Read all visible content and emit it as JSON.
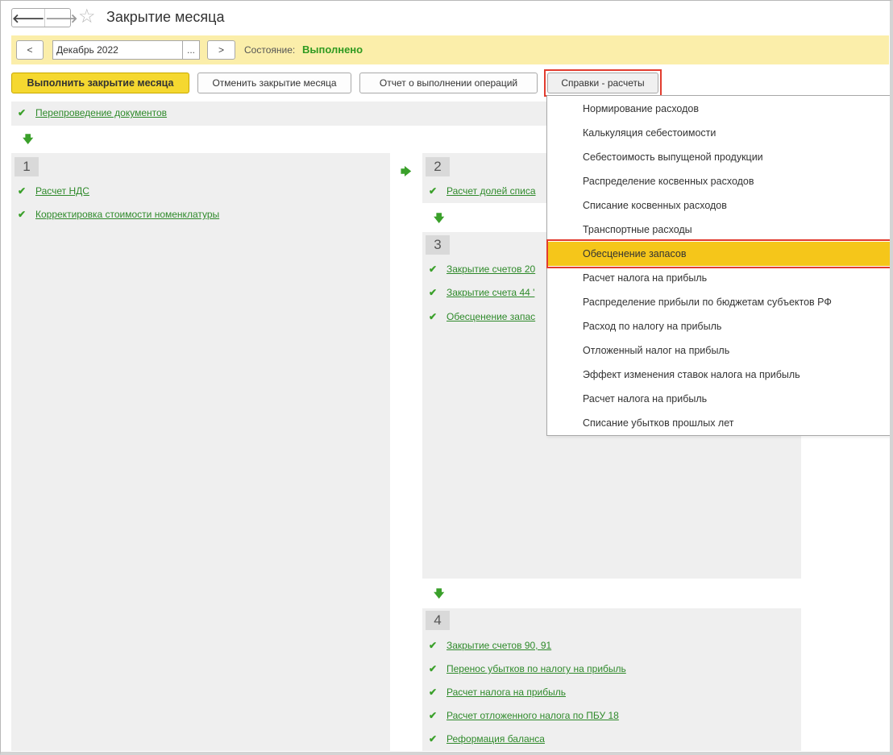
{
  "window": {
    "title": "Закрытие месяца",
    "back_glyph": "🡐",
    "forward_glyph": "🡒",
    "star_glyph": "☆"
  },
  "period_bar": {
    "prev_label": "<",
    "next_label": ">",
    "period_value": "Декабрь 2022",
    "select_label": "...",
    "state_label": "Состояние:",
    "state_value": "Выполнено"
  },
  "toolbar": {
    "run_label": "Выполнить закрытие месяца",
    "cancel_label": "Отменить закрытие месяца",
    "report_label": "Отчет о выполнении операций",
    "reports_menu_label": "Справки - расчеты"
  },
  "operations": {
    "reposting": "Перепроведение документов",
    "step1": {
      "number": "1",
      "items": [
        "Расчет НДС",
        "Корректировка стоимости номенклатуры"
      ]
    },
    "step2": {
      "number": "2",
      "items": [
        "Расчет долей списа"
      ]
    },
    "step3": {
      "number": "3",
      "items": [
        "Закрытие счетов 20",
        "Закрытие счета 44 '",
        "Обесценение запас"
      ]
    },
    "step4": {
      "number": "4",
      "items": [
        "Закрытие счетов 90, 91",
        "Перенос убытков по налогу на прибыль",
        "Расчет налога на прибыль",
        "Расчет отложенного налога по ПБУ 18",
        "Реформация баланса"
      ]
    }
  },
  "reports_menu": {
    "items": [
      "Нормирование расходов",
      "Калькуляция себестоимости",
      "Себестоимость выпущеной продукции",
      "Распределение косвенных расходов",
      "Списание косвенных расходов",
      "Транспортные расходы",
      "Обесценение запасов",
      "Расчет налога на прибыль",
      "Распределение прибыли по бюджетам субъектов РФ",
      "Расход по налогу на прибыль",
      "Отложенный налог на прибыль",
      "Эффект изменения ставок налога на прибыль",
      "Расчет налога на прибыль",
      "Списание убытков прошлых лет"
    ],
    "highlighted_item": "Обесценение запасов"
  },
  "colors": {
    "accent_yellow": "#f5d830",
    "period_bar": "#fbeeaa",
    "link_green": "#2f8a2b",
    "state_green": "#2f9a20",
    "menu_highlight": "#f5c61a",
    "callout_red": "#e23c2f"
  },
  "icons": {
    "check": "check-icon",
    "arrow_down": "arrow-down-icon",
    "arrow_right": "arrow-right-icon",
    "star": "star-icon"
  },
  "glyphs": {
    "check": "✔",
    "down": "🡇",
    "right": "🡆"
  }
}
